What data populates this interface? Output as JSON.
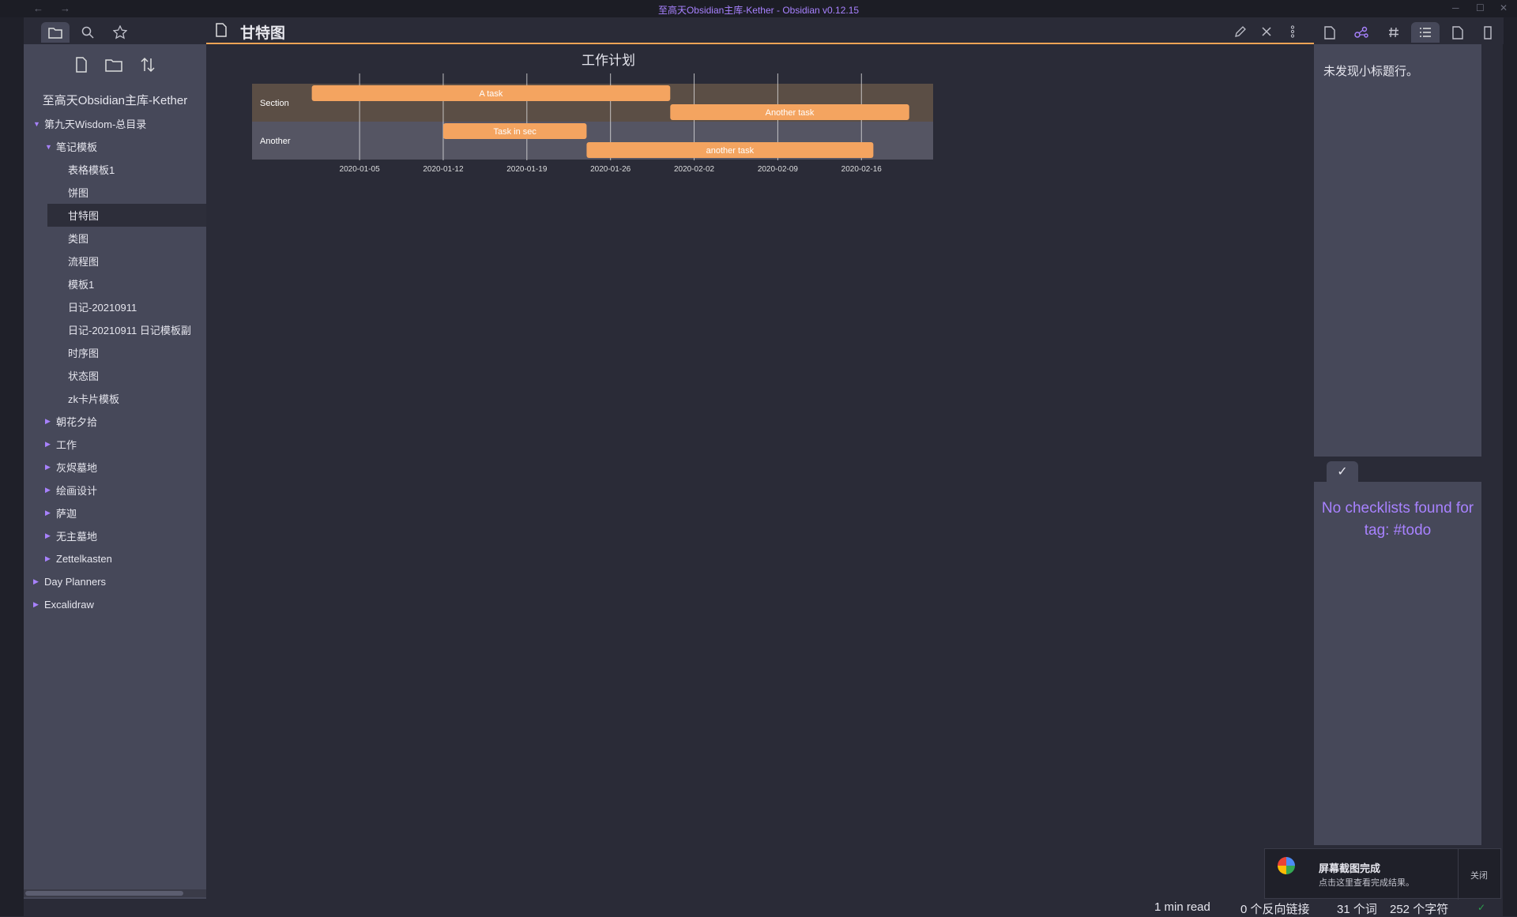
{
  "window": {
    "title": "至高天Obsidian主库-Kether - Obsidian v0.12.15",
    "back_icon": "←",
    "forward_icon": "→",
    "minimize": "─",
    "maximize": "☐",
    "close": "✕"
  },
  "sidebar": {
    "vault_name": "至高天Obsidian主库-Kether",
    "tree": [
      {
        "label": "第九天Wisdom-总目录",
        "depth": 0,
        "arrow": "▼"
      },
      {
        "label": "笔记模板",
        "depth": 1,
        "arrow": "▼"
      },
      {
        "label": "表格模板1",
        "depth": 2,
        "arrow": ""
      },
      {
        "label": "饼图",
        "depth": 2,
        "arrow": ""
      },
      {
        "label": "甘特图",
        "depth": 2,
        "arrow": "",
        "active": true
      },
      {
        "label": "类图",
        "depth": 2,
        "arrow": ""
      },
      {
        "label": "流程图",
        "depth": 2,
        "arrow": ""
      },
      {
        "label": "模板1",
        "depth": 2,
        "arrow": ""
      },
      {
        "label": "日记-20210911",
        "depth": 2,
        "arrow": ""
      },
      {
        "label": "日记-20210911 日记模板副",
        "depth": 2,
        "arrow": ""
      },
      {
        "label": "时序图",
        "depth": 2,
        "arrow": ""
      },
      {
        "label": "状态图",
        "depth": 2,
        "arrow": ""
      },
      {
        "label": "zk卡片模板",
        "depth": 2,
        "arrow": ""
      },
      {
        "label": "朝花夕拾",
        "depth": 1,
        "arrow": "▶"
      },
      {
        "label": "工作",
        "depth": 1,
        "arrow": "▶"
      },
      {
        "label": "灰烬墓地",
        "depth": 1,
        "arrow": "▶"
      },
      {
        "label": "绘画设计",
        "depth": 1,
        "arrow": "▶"
      },
      {
        "label": "萨迦",
        "depth": 1,
        "arrow": "▶"
      },
      {
        "label": "无主墓地",
        "depth": 1,
        "arrow": "▶"
      },
      {
        "label": "Zettelkasten",
        "depth": 1,
        "arrow": "▶"
      },
      {
        "label": "Day Planners",
        "depth": 0,
        "arrow": "▶"
      },
      {
        "label": "Excalidraw",
        "depth": 0,
        "arrow": "▶"
      }
    ]
  },
  "editor": {
    "title": "甘特图"
  },
  "chart_data": {
    "type": "gantt",
    "title": "工作计划",
    "x_ticks": [
      "2020-01-05",
      "2020-01-12",
      "2020-01-19",
      "2020-01-26",
      "2020-02-02",
      "2020-02-09",
      "2020-02-16"
    ],
    "xlim": [
      "2019-12-27",
      "2020-02-22"
    ],
    "sections": [
      {
        "name": "Section",
        "color": "#5b4e45"
      },
      {
        "name": "Another",
        "color": "#555563"
      }
    ],
    "tasks": [
      {
        "name": "A task",
        "section": "Section",
        "start": "2020-01-01",
        "end": "2020-01-31"
      },
      {
        "name": "Another task",
        "section": "Section",
        "start": "2020-01-31",
        "end": "2020-02-20"
      },
      {
        "name": "Task in sec",
        "section": "Another",
        "start": "2020-01-12",
        "end": "2020-01-24"
      },
      {
        "name": "another task",
        "section": "Another",
        "start": "2020-01-24",
        "end": "2020-02-17"
      }
    ],
    "bar_color": "#f4a460"
  },
  "outline": {
    "empty_text": "未发现小标题行。"
  },
  "checklist": {
    "tab_icon": "✓",
    "message": "No checklists found for tag: #todo"
  },
  "status": {
    "read_time": "1 min read",
    "backlinks": "0 个反向链接",
    "words": "31 个词",
    "chars": "252 个字符",
    "sync_icon": "✓"
  },
  "toast": {
    "title": "屏幕截图完成",
    "subtitle": "点击这里查看完成结果。",
    "close_label": "关闭"
  }
}
